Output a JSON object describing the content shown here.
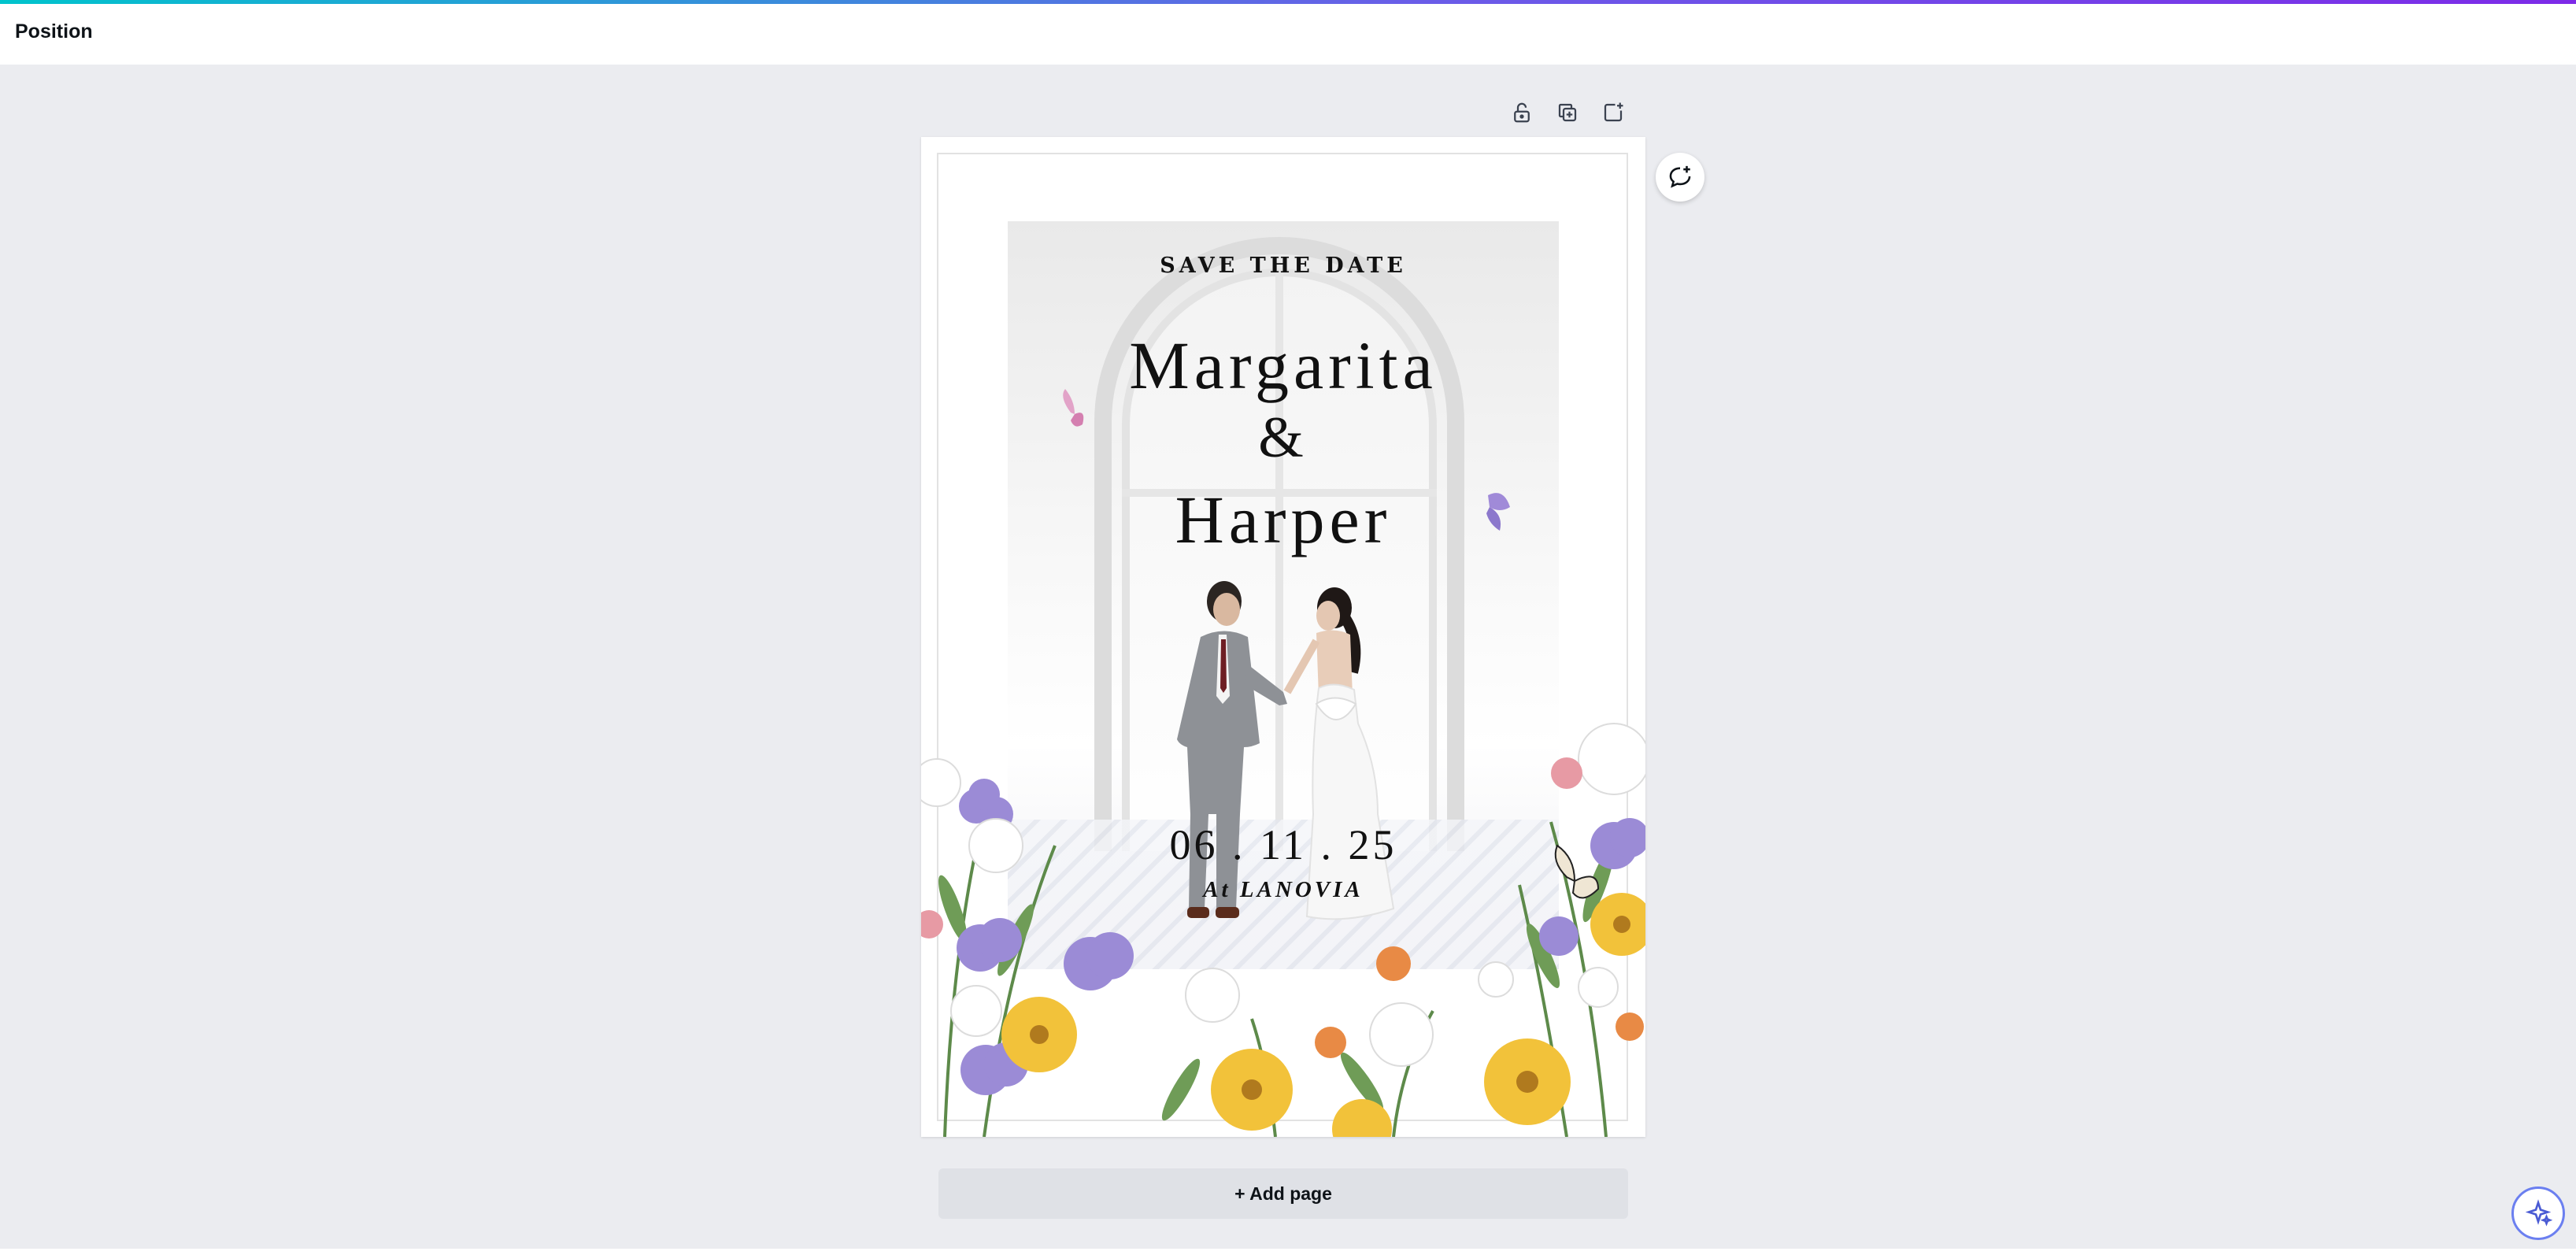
{
  "topbar": {
    "title": "Position"
  },
  "page_toolbar": {
    "lock_icon": "lock-icon",
    "duplicate_icon": "duplicate-page-icon",
    "add_icon": "add-page-icon"
  },
  "design": {
    "kicker": "SAVE THE DATE",
    "name_one": "Margarita",
    "ampersand": "&",
    "name_two": "Harper",
    "date": "06 . 11 . 25",
    "venue": "At LANOVIA"
  },
  "comment_icon": "add-comment-icon",
  "add_page_label": "+ Add page",
  "assistant_icon": "magic-sparkle-icon",
  "colors": {
    "accent_gradient_start": "#00c4cc",
    "accent_gradient_end": "#7d2ae8",
    "canvas_background": "#ebecf0"
  }
}
